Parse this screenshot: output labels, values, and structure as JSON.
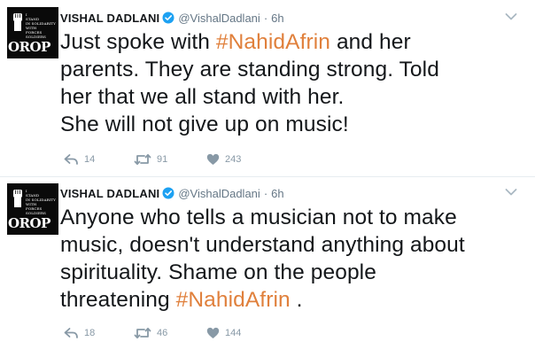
{
  "colors": {
    "hashtag": "#e0803c",
    "meta": "#657786",
    "action_icons": "#8899a6",
    "verified_badge": "#1da1f2"
  },
  "tweets": [
    {
      "author": {
        "name": "VISHAL DADLANI",
        "handle": "@VishalDadlani",
        "verified": true,
        "avatar": {
          "brand": "OROP",
          "slogan": [
            "I",
            "STAND",
            "IN SOLIDARITY",
            "WITH",
            "FORCES SOLDIERS"
          ],
          "icon": "raised-fist-icon"
        }
      },
      "separator": "·",
      "time": "6h",
      "text_lines": [
        [
          "Just spoke with ",
          "#NahidAfrin",
          " and her"
        ],
        [
          "parents. They are standing strong. Told",
          "",
          ""
        ],
        [
          "her that we all stand with her.",
          "",
          ""
        ],
        [
          "She will not give up on music!",
          "",
          ""
        ]
      ],
      "counts": {
        "reply": "14",
        "retweet": "91",
        "like": "243"
      }
    },
    {
      "author": {
        "name": "VISHAL DADLANI",
        "handle": "@VishalDadlani",
        "verified": true,
        "avatar": {
          "brand": "OROP",
          "slogan": [
            "I",
            "STAND",
            "IN SOLIDARITY",
            "WITH",
            "FORCES SOLDIERS"
          ],
          "icon": "raised-fist-icon"
        }
      },
      "separator": "·",
      "time": "6h",
      "text_lines": [
        [
          "Anyone who tells a musician not to make",
          "",
          ""
        ],
        [
          "music, doesn't understand anything about",
          "",
          ""
        ],
        [
          "spirituality. Shame on the people",
          "",
          ""
        ],
        [
          "threatening ",
          "#NahidAfrin",
          " ."
        ]
      ],
      "counts": {
        "reply": "18",
        "retweet": "46",
        "like": "144"
      }
    }
  ]
}
